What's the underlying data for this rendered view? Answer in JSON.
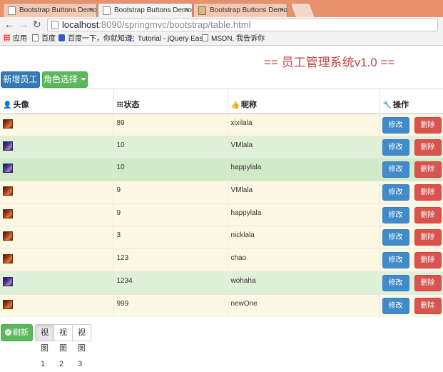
{
  "browser": {
    "tabs": [
      {
        "title": "Bootstrap Buttons Demo",
        "active": false
      },
      {
        "title": "Bootstrap Buttons Demo",
        "active": true
      },
      {
        "title": "Bootstrap Buttons Demo",
        "active": false
      }
    ],
    "url_host": "localhost",
    "url_rest": ":8090/springmvc/bootstrap/table.html",
    "bookmarks": [
      "应用",
      "百度",
      "百度一下，你就知道",
      "Tutorial - jQuery Eas",
      "MSDN, 我告诉你"
    ]
  },
  "page": {
    "system_title": "== 员工管理系统v1.0 ==",
    "add_employee": "新增员工",
    "role_select": "角色选择"
  },
  "table": {
    "headers": {
      "avatar": "头像",
      "status": "状态",
      "nickname": "昵称",
      "actions": "操作"
    },
    "edit_label": "修改",
    "delete_label": "删除",
    "rows": [
      {
        "avatar": "orange",
        "status": "89",
        "nickname": "xixilala",
        "style": "warning"
      },
      {
        "avatar": "blue",
        "status": "10",
        "nickname": "VMlala",
        "style": "success"
      },
      {
        "avatar": "blue",
        "status": "10",
        "nickname": "happylala",
        "style": "success-strong"
      },
      {
        "avatar": "orange",
        "status": "9",
        "nickname": "VMlala",
        "style": "warning"
      },
      {
        "avatar": "orange",
        "status": "9",
        "nickname": "happylala",
        "style": "warning"
      },
      {
        "avatar": "orange",
        "status": "3",
        "nickname": "nicklala",
        "style": "warning"
      },
      {
        "avatar": "orange",
        "status": "123",
        "nickname": "chao",
        "style": "warning"
      },
      {
        "avatar": "blue",
        "status": "1234",
        "nickname": "wohaha",
        "style": "success"
      },
      {
        "avatar": "orange",
        "status": "999",
        "nickname": "newOne",
        "style": "warning"
      }
    ]
  },
  "footer": {
    "refresh": "刷新",
    "views": [
      "视图1",
      "视图2",
      "视图3"
    ],
    "active_view": 0
  },
  "colors": {
    "title": "#c64545",
    "primary": "#337ab7",
    "success": "#5cb85c",
    "danger": "#d9534f",
    "row_warning": "#fcf8e3",
    "row_success": "#dff0d8"
  }
}
